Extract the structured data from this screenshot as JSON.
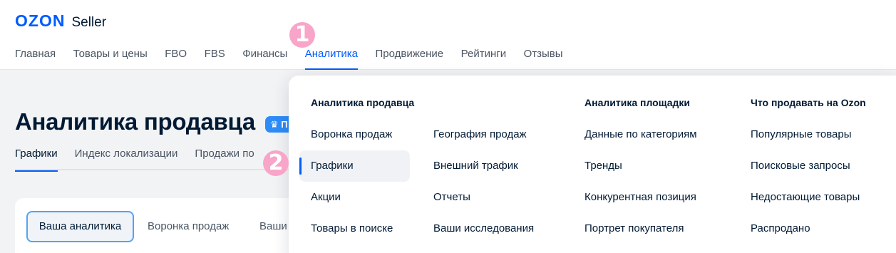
{
  "header": {
    "logo_brand": "OZON",
    "logo_product": "Seller",
    "nav": [
      "Главная",
      "Товары и цены",
      "FBO",
      "FBS",
      "Финансы",
      "Аналитика",
      "Продвижение",
      "Рейтинги",
      "Отзывы"
    ],
    "active_nav": "Аналитика"
  },
  "markers": [
    "1",
    "2"
  ],
  "page": {
    "title": "Аналитика продавца",
    "badge": "♛ П",
    "subtabs": [
      "Графики",
      "Индекс локализации",
      "Продажи по"
    ],
    "segments": [
      "Ваша аналитика",
      "Воронка продаж",
      "Ваши"
    ]
  },
  "dropdown": {
    "col1_head": "Аналитика продавца",
    "col1a": [
      "Воронка продаж",
      "Графики",
      "Акции",
      "Товары в поиске"
    ],
    "col1b": [
      "География продаж",
      "Внешний трафик",
      "Отчеты",
      "Ваши исследования"
    ],
    "col2_head": "Аналитика площадки",
    "col2": [
      "Данные по категориям",
      "Тренды",
      "Конкурентная позиция",
      "Портрет покупателя"
    ],
    "col3_head": "Что продавать на Ozon",
    "col3": [
      "Популярные товары",
      "Поисковые запросы",
      "Недостающие товары",
      "Распродано"
    ]
  },
  "colors": {
    "accent": "#005bff",
    "marker": "#f8a5c9",
    "badge": "#2d8cf7"
  }
}
